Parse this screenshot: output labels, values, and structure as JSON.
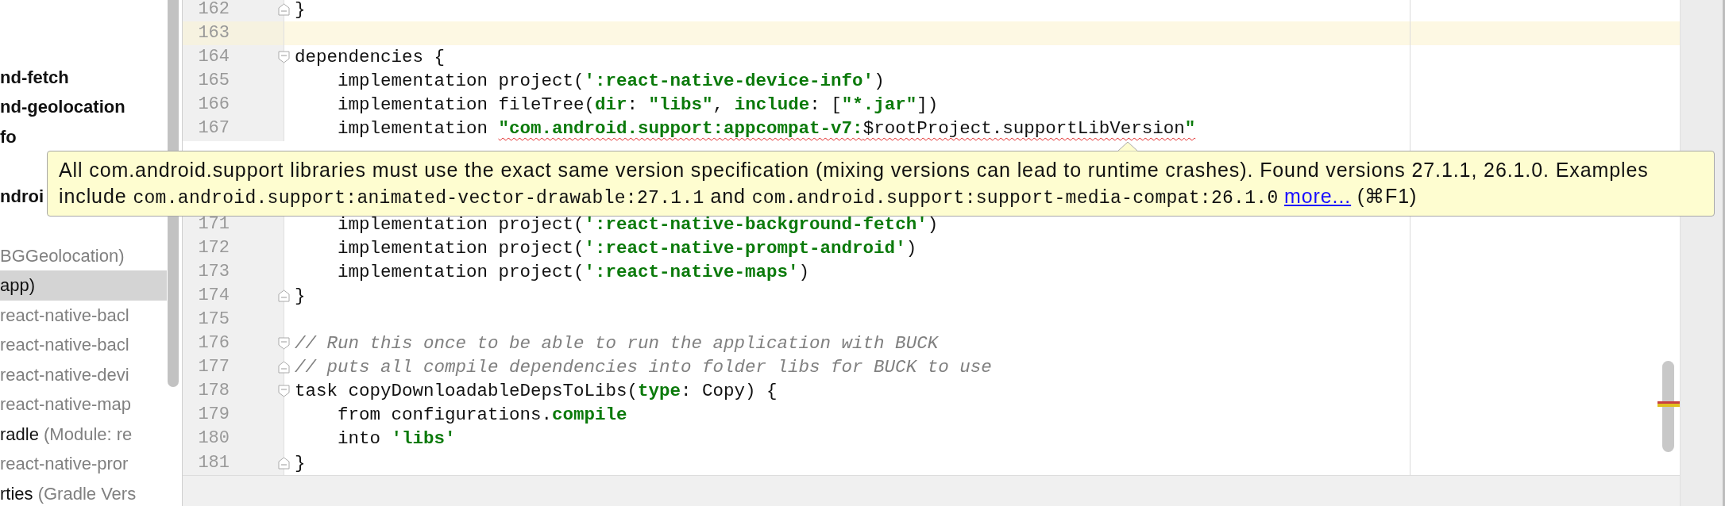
{
  "sidebar": {
    "items": [
      {
        "gap_before": true,
        "selected": false,
        "parts": [
          {
            "kind": "bold",
            "text": "nd-fetch"
          }
        ]
      },
      {
        "gap_before": false,
        "selected": false,
        "parts": [
          {
            "kind": "bold",
            "text": "nd-geolocation"
          }
        ]
      },
      {
        "gap_before": false,
        "selected": false,
        "parts": [
          {
            "kind": "bold",
            "text": "fo"
          }
        ]
      },
      {
        "gap_before": true,
        "selected": false,
        "parts": [
          {
            "kind": "bold",
            "text": "ndroi"
          }
        ]
      },
      {
        "gap_before": true,
        "selected": false,
        "parts": [
          {
            "kind": "muted",
            "text": "BGGeolocation)"
          }
        ]
      },
      {
        "gap_before": false,
        "selected": true,
        "parts": [
          {
            "kind": "plain",
            "text": "app)"
          }
        ]
      },
      {
        "gap_before": false,
        "selected": false,
        "parts": [
          {
            "kind": "muted",
            "text": "react-native-bacl"
          }
        ]
      },
      {
        "gap_before": false,
        "selected": false,
        "parts": [
          {
            "kind": "muted",
            "text": "react-native-bacl"
          }
        ]
      },
      {
        "gap_before": false,
        "selected": false,
        "parts": [
          {
            "kind": "muted",
            "text": "react-native-devi"
          }
        ]
      },
      {
        "gap_before": false,
        "selected": false,
        "parts": [
          {
            "kind": "muted",
            "text": "react-native-map"
          }
        ]
      },
      {
        "gap_before": false,
        "selected": false,
        "parts": [
          {
            "kind": "plain",
            "text": "radle"
          },
          {
            "kind": "muted",
            "text": " (Module: re"
          }
        ]
      },
      {
        "gap_before": false,
        "selected": false,
        "parts": [
          {
            "kind": "muted",
            "text": "react-native-pror"
          }
        ]
      },
      {
        "gap_before": false,
        "selected": false,
        "parts": [
          {
            "kind": "plain",
            "text": "rties"
          },
          {
            "kind": "muted",
            "text": " (Gradle Vers"
          }
        ]
      }
    ]
  },
  "editor": {
    "lines": [
      {
        "number": "162",
        "current": false,
        "kind": "fold_end",
        "tokens": [
          {
            "kind": "plain",
            "text": "}"
          }
        ]
      },
      {
        "number": "163",
        "current": true
      },
      {
        "number": "164",
        "current": false,
        "kind": "fold_start",
        "tokens": [
          {
            "kind": "plain",
            "text": "dependencies {"
          }
        ]
      },
      {
        "number": "165",
        "current": false,
        "tokens": [
          {
            "kind": "plain",
            "text": "    implementation project("
          },
          {
            "kind": "string",
            "text": "':react-native-device-info'"
          },
          {
            "kind": "plain",
            "text": ")"
          }
        ]
      },
      {
        "number": "166",
        "current": false,
        "tokens": [
          {
            "kind": "plain",
            "text": "    implementation fileTree("
          },
          {
            "kind": "key",
            "text": "dir"
          },
          {
            "kind": "plain",
            "text": ": "
          },
          {
            "kind": "string",
            "text": "\"libs\""
          },
          {
            "kind": "plain",
            "text": ", "
          },
          {
            "kind": "key",
            "text": "include"
          },
          {
            "kind": "plain",
            "text": ": ["
          },
          {
            "kind": "string",
            "text": "\"*.jar\""
          },
          {
            "kind": "plain",
            "text": "])"
          }
        ]
      },
      {
        "number": "167",
        "current": false,
        "tokens": [
          {
            "kind": "plain",
            "text": "    implementation "
          },
          {
            "kind": "string",
            "error": true,
            "text": "\"com.android.support:appcompat-v7:"
          },
          {
            "kind": "plain",
            "error": true,
            "text": "$rootProject.supportLibVersion"
          },
          {
            "kind": "string",
            "error": true,
            "text": "\""
          }
        ],
        "tooltip": {
          "lines": [
            [
              {
                "kind": "text",
                "text": "All com.android.support libraries must use the exact same version specification (mixing versions can lead to runtime crashes). Found versions 27.1.1, 26.1.0. Examples"
              }
            ],
            [
              {
                "kind": "text",
                "text": "include "
              },
              {
                "kind": "code",
                "text": "com.android.support:animated-vector-drawable:27.1.1"
              },
              {
                "kind": "text",
                "text": " and "
              },
              {
                "kind": "code",
                "text": "com.android.support:support-media-compat:26.1.0"
              },
              {
                "kind": "link",
                "text": "more..."
              },
              {
                "kind": "text",
                "text": " (⌘F1)"
              }
            ]
          ]
        }
      },
      {
        "number": "171",
        "current": false,
        "tokens": [
          {
            "kind": "plain",
            "text": "    implementation project("
          },
          {
            "kind": "string",
            "text": "':react-native-background-fetch'"
          },
          {
            "kind": "plain",
            "text": ")"
          }
        ]
      },
      {
        "number": "172",
        "current": false,
        "tokens": [
          {
            "kind": "plain",
            "text": "    implementation project("
          },
          {
            "kind": "string",
            "text": "':react-native-prompt-android'"
          },
          {
            "kind": "plain",
            "text": ")"
          }
        ]
      },
      {
        "number": "173",
        "current": false,
        "tokens": [
          {
            "kind": "plain",
            "text": "    implementation project("
          },
          {
            "kind": "string",
            "text": "':react-native-maps'"
          },
          {
            "kind": "plain",
            "text": ")"
          }
        ]
      },
      {
        "number": "174",
        "current": false,
        "kind": "fold_end",
        "tokens": [
          {
            "kind": "plain",
            "text": "}"
          }
        ]
      },
      {
        "number": "175",
        "current": false
      },
      {
        "number": "176",
        "current": false,
        "kind": "fold_start",
        "tokens": [
          {
            "kind": "comment",
            "text": "// Run this once to be able to run the application with BUCK"
          }
        ]
      },
      {
        "number": "177",
        "current": false,
        "kind": "fold_end",
        "tokens": [
          {
            "kind": "comment",
            "text": "// puts all compile dependencies into folder libs for BUCK to use"
          }
        ]
      },
      {
        "number": "178",
        "current": false,
        "kind": "fold_start",
        "tokens": [
          {
            "kind": "plain",
            "text": "task copyDownloadableDepsToLibs("
          },
          {
            "kind": "key",
            "text": "type"
          },
          {
            "kind": "plain",
            "text": ": Copy) {"
          }
        ]
      },
      {
        "number": "179",
        "current": false,
        "tokens": [
          {
            "kind": "plain",
            "text": "    from configurations."
          },
          {
            "kind": "key",
            "text": "compile"
          }
        ]
      },
      {
        "number": "180",
        "current": false,
        "tokens": [
          {
            "kind": "plain",
            "text": "    into "
          },
          {
            "kind": "string",
            "text": "'libs'"
          }
        ]
      },
      {
        "number": "181",
        "current": false,
        "kind": "fold_end",
        "tokens": [
          {
            "kind": "plain",
            "text": "}"
          }
        ]
      }
    ]
  }
}
